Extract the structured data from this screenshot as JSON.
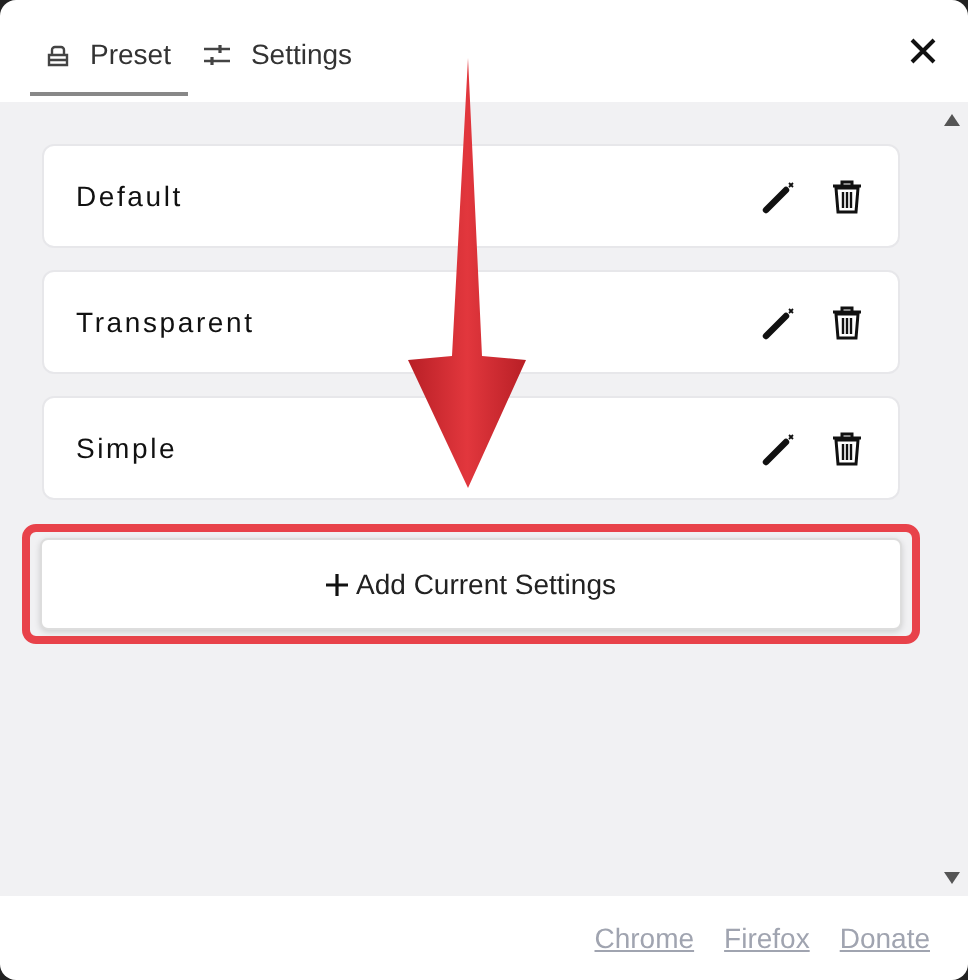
{
  "tabs": [
    {
      "label": "Preset",
      "kind": "preset",
      "selected": true
    },
    {
      "label": "Settings",
      "kind": "settings",
      "selected": false
    }
  ],
  "presets": [
    {
      "name": "Default"
    },
    {
      "name": "Transparent"
    },
    {
      "name": "Simple"
    }
  ],
  "add_button": {
    "label": "Add Current Settings",
    "highlighted": true
  },
  "footer_links": [
    "Chrome",
    "Firefox",
    "Donate"
  ]
}
